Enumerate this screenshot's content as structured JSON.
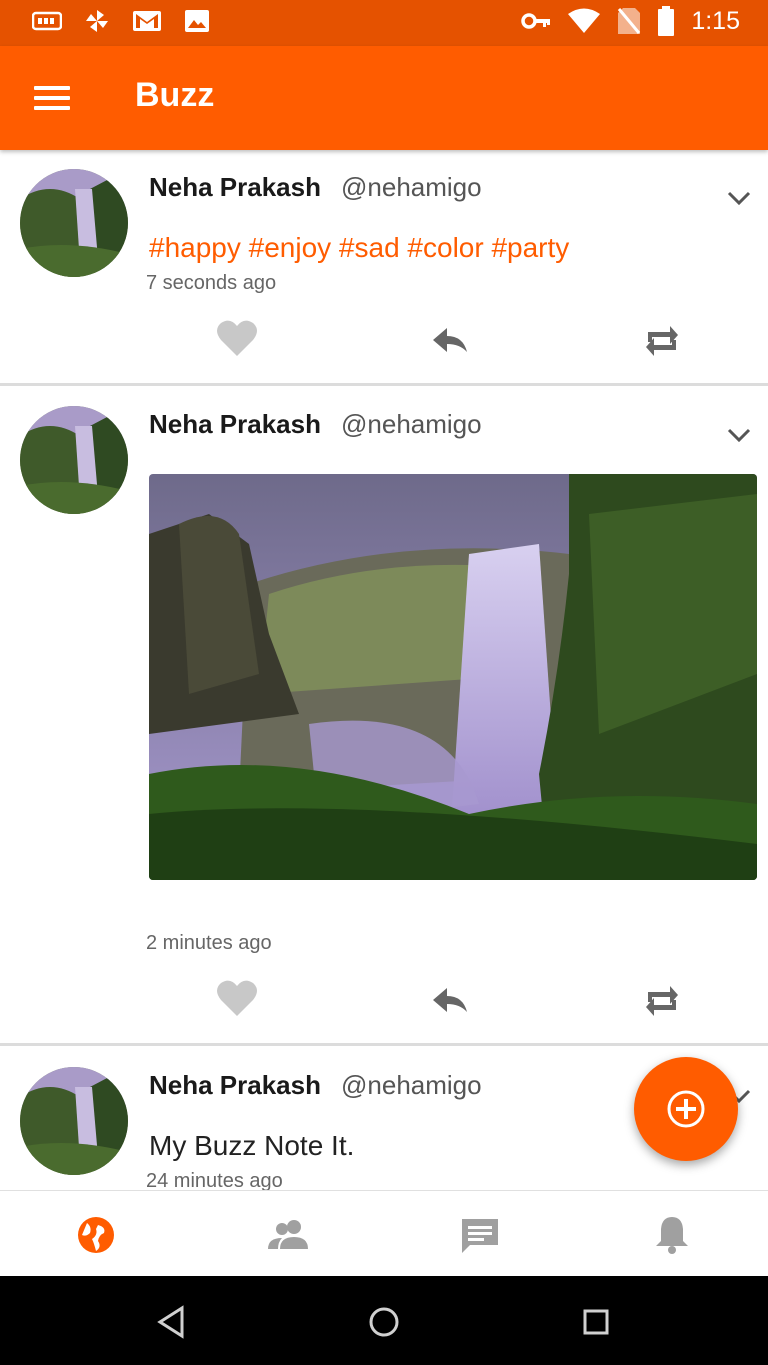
{
  "status_bar": {
    "time": "1:15",
    "icons_left": [
      "keyboard-icon",
      "pinwheel-icon",
      "gmail-icon",
      "image-icon"
    ],
    "icons_right": [
      "vpn-key-icon",
      "wifi-icon",
      "no-sim-icon",
      "battery-icon"
    ]
  },
  "app_bar": {
    "title": "Buzz",
    "menu_icon": "hamburger-menu-icon"
  },
  "posts": [
    {
      "author": "Neha Prakash",
      "handle": "@nehamigo",
      "tags": "#happy #enjoy #sad #color #party",
      "time": "7 seconds ago"
    },
    {
      "author": "Neha Prakash",
      "handle": "@nehamigo",
      "has_image": true,
      "image": "waterfall-photo",
      "time": "2 minutes ago"
    },
    {
      "author": "Neha Prakash",
      "handle": "@nehamigo",
      "text": "My Buzz Note It.",
      "time": "24 minutes ago"
    }
  ],
  "actions": [
    "heart-icon",
    "reply-icon",
    "repost-icon"
  ],
  "fab": {
    "icon": "add-circle-icon"
  },
  "bottom_nav": {
    "items": [
      {
        "icon": "globe-icon",
        "active": true
      },
      {
        "icon": "people-icon",
        "active": false
      },
      {
        "icon": "message-icon",
        "active": false
      },
      {
        "icon": "bell-icon",
        "active": false
      }
    ]
  },
  "colors": {
    "accent": "#ff5c00",
    "status_bar": "#e55200",
    "inactive_icon": "#a0a0a0"
  }
}
